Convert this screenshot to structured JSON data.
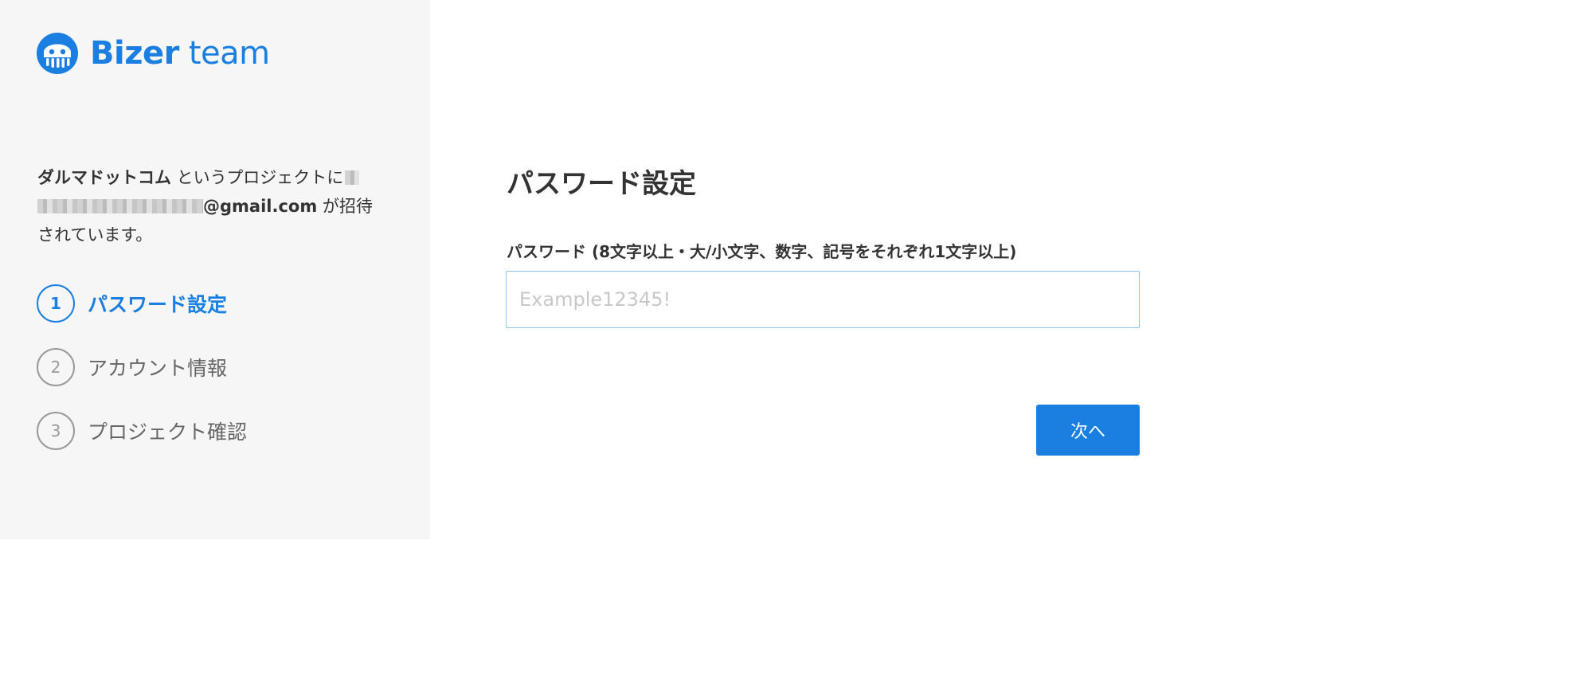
{
  "brand": {
    "name_bold": "Bizer",
    "name_light": "team",
    "color": "#1a7fe0",
    "logo_icon": "octopus-logo-icon"
  },
  "invite": {
    "project_name": "ダルマドットコム",
    "text_before_email": " というプロジェクトに",
    "email_domain": "@gmail.com",
    "text_after_email": " が招待",
    "text_line3": "されています。"
  },
  "steps": [
    {
      "number": "1",
      "label": "パスワード設定",
      "active": true
    },
    {
      "number": "2",
      "label": "アカウント情報",
      "active": false
    },
    {
      "number": "3",
      "label": "プロジェクト確認",
      "active": false
    }
  ],
  "form": {
    "title": "パスワード設定",
    "password_label": "パスワード (8文字以上・大/小文字、数字、記号をそれぞれ1文字以上)",
    "password_placeholder": "Example12345!",
    "password_value": "",
    "next_label": "次へ"
  },
  "colors": {
    "accent": "#1a7fe0",
    "sidebar_bg": "#f6f6f6",
    "inactive_step": "#999999"
  }
}
